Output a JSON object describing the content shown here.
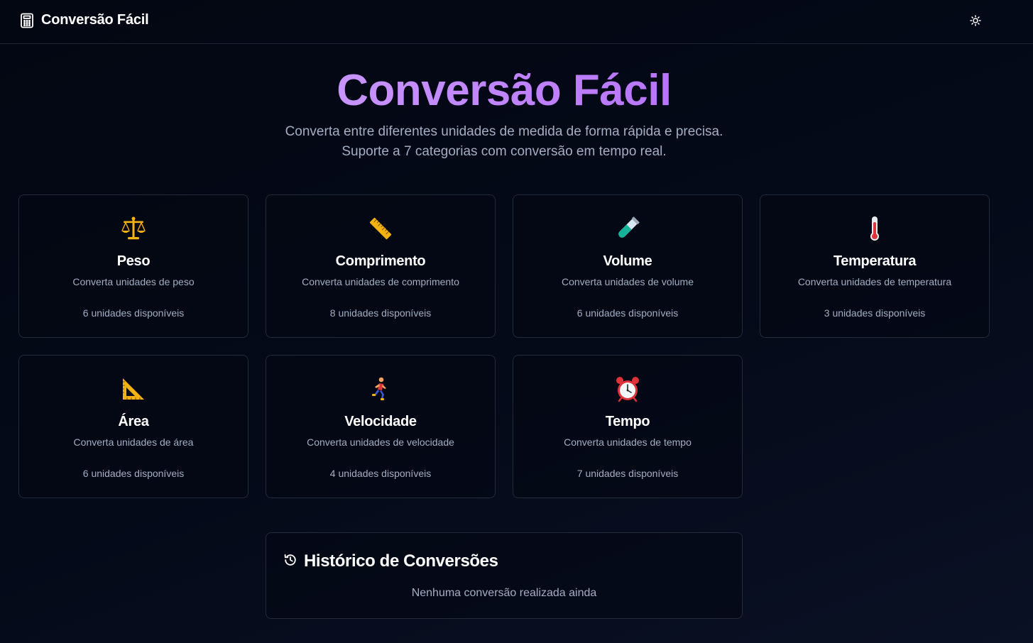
{
  "header": {
    "brand_name": "Conversão Fácil",
    "brand_icon": "calculator-icon",
    "theme_toggle_icon": "sun-icon"
  },
  "hero": {
    "title": "Conversão Fácil",
    "subtitle_line1": "Converta entre diferentes unidades de medida de forma rápida e precisa.",
    "subtitle_line2": "Suporte a 7 categorias com conversão em tempo real."
  },
  "categories": [
    {
      "icon": "balance-scale-icon",
      "title": "Peso",
      "description": "Converta unidades de peso",
      "units": "6 unidades disponíveis"
    },
    {
      "icon": "ruler-icon",
      "title": "Comprimento",
      "description": "Converta unidades de comprimento",
      "units": "8 unidades disponíveis"
    },
    {
      "icon": "test-tube-icon",
      "title": "Volume",
      "description": "Converta unidades de volume",
      "units": "6 unidades disponíveis"
    },
    {
      "icon": "thermometer-icon",
      "title": "Temperatura",
      "description": "Converta unidades de temperatura",
      "units": "3 unidades disponíveis"
    },
    {
      "icon": "triangular-ruler-icon",
      "title": "Área",
      "description": "Converta unidades de área",
      "units": "6 unidades disponíveis"
    },
    {
      "icon": "runner-icon",
      "title": "Velocidade",
      "description": "Converta unidades de velocidade",
      "units": "4 unidades disponíveis"
    },
    {
      "icon": "alarm-clock-icon",
      "title": "Tempo",
      "description": "Converta unidades de tempo",
      "units": "7 unidades disponíveis"
    }
  ],
  "history": {
    "icon": "history-icon",
    "title": "Histórico de Conversões",
    "empty_message": "Nenhuma conversão realizada ainda"
  },
  "colors": {
    "background": "#030712",
    "accent_gradient_start": "#d8b4fe",
    "accent_gradient_end": "#a855f7",
    "muted_text": "#a3aec2",
    "card_border": "#232a3a"
  }
}
